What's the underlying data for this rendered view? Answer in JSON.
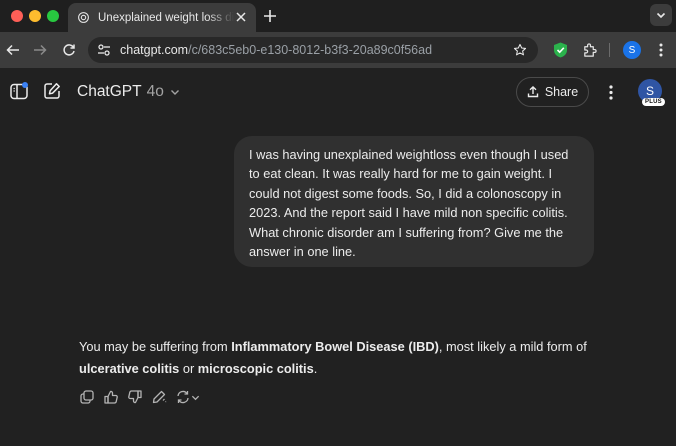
{
  "browser": {
    "tab_title": "Unexplained weight loss diag",
    "url_host": "chatgpt.com",
    "url_path": "/c/683c5eb0-e130-8012-b3f3-20a89c0f56ad",
    "profile_initial": "S"
  },
  "header": {
    "model_name": "ChatGPT",
    "model_version": "4o",
    "share_label": "Share",
    "avatar_initial": "S",
    "plan_badge": "PLUS"
  },
  "conversation": {
    "user_message": "I was having unexplained weightloss even though I used to eat clean. It was really hard for me to gain weight. I could not digest some foods. So, I did a colonoscopy in 2023. And the report said I have mild non specific colitis. What chronic disorder am I suffering from? Give me the answer in one line.",
    "assistant": {
      "part1": "You may be suffering from ",
      "bold1": "Inflammatory Bowel Disease (IBD)",
      "part2": ", most likely a mild form of ",
      "bold2": "ulcerative colitis",
      "part3": " or ",
      "bold3": "microscopic colitis",
      "part4": "."
    }
  },
  "icons": [
    "tab-favicon-icon",
    "close-icon",
    "plus-icon",
    "chevron-down-icon",
    "back-arrow-icon",
    "forward-arrow-icon",
    "reload-icon",
    "site-info-icon",
    "star-icon",
    "shield-icon",
    "extensions-icon",
    "kebab-icon",
    "sidebar-icon",
    "compose-icon",
    "upload-icon",
    "copy-icon",
    "thumbs-up-icon",
    "thumbs-down-icon",
    "edit-icon",
    "regenerate-icon"
  ],
  "colors": {
    "background": "#212121",
    "bubble": "#303030",
    "accent_blue": "#3b82f6"
  }
}
